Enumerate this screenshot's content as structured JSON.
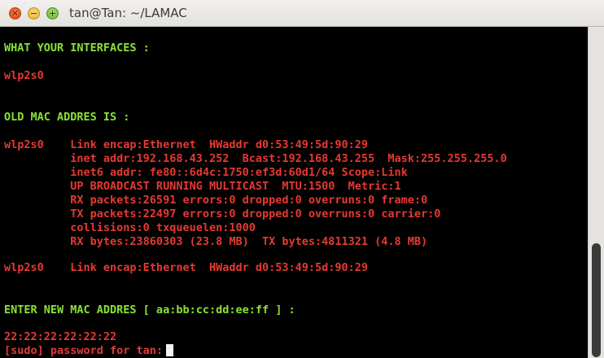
{
  "window": {
    "title": "tan@Tan: ~/LAMAC",
    "buttons": {
      "close": "×",
      "minimize": "−",
      "maximize": "+"
    }
  },
  "terminal": {
    "lines": [
      {
        "text": "WHAT YOUR INTERFACES :",
        "color": "#8ae234"
      },
      {
        "text": "wlp2s0",
        "color": "#e53a32"
      },
      {
        "text": "OLD MAC ADDRES IS :",
        "color": "#8ae234"
      },
      {
        "text": "wlp2s0    Link encap:Ethernet  HWaddr d0:53:49:5d:90:29",
        "color": "#e53a32"
      },
      {
        "text": "          inet addr:192.168.43.252  Bcast:192.168.43.255  Mask:255.255.255.0",
        "color": "#e53a32"
      },
      {
        "text": "          inet6 addr: fe80::6d4c:1750:ef3d:60d1/64 Scope:Link",
        "color": "#e53a32"
      },
      {
        "text": "          UP BROADCAST RUNNING MULTICAST  MTU:1500  Metric:1",
        "color": "#e53a32"
      },
      {
        "text": "          RX packets:26591 errors:0 dropped:0 overruns:0 frame:0",
        "color": "#e53a32"
      },
      {
        "text": "          TX packets:22497 errors:0 dropped:0 overruns:0 carrier:0",
        "color": "#e53a32"
      },
      {
        "text": "          collisions:0 txqueuelen:1000",
        "color": "#e53a32"
      },
      {
        "text": "          RX bytes:23860303 (23.8 MB)  TX bytes:4811321 (4.8 MB)",
        "color": "#e53a32"
      },
      {
        "text": "wlp2s0    Link encap:Ethernet  HWaddr d0:53:49:5d:90:29",
        "color": "#e53a32"
      },
      {
        "text": "ENTER NEW MAC ADDRES [ aa:bb:cc:dd:ee:ff ] :",
        "color": "#8ae234"
      },
      {
        "text": "22:22:22:22:22:22",
        "color": "#e53a32"
      },
      {
        "text": "[sudo] password for tan:",
        "color": "#e53a32"
      }
    ],
    "scroll_position": 1.0
  }
}
